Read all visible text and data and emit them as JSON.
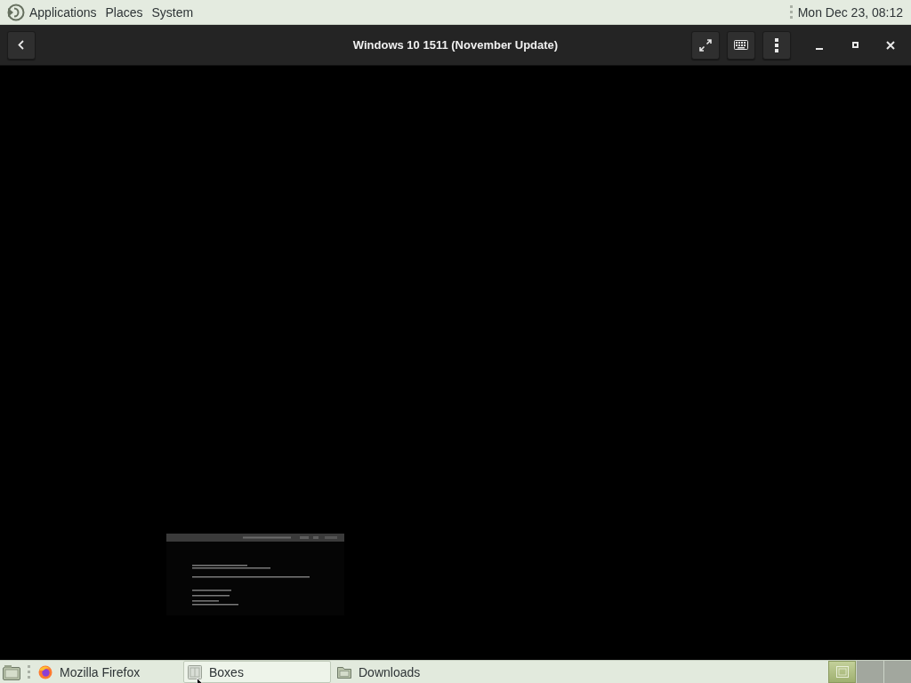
{
  "top_panel": {
    "menus": [
      "Applications",
      "Places",
      "System"
    ],
    "clock": "Mon Dec 23, 08:12"
  },
  "header_bar": {
    "title": "Windows 10 1511 (November Update)"
  },
  "taskbar": {
    "windows": [
      {
        "label": "Mozilla Firefox",
        "kind": "browser",
        "selected": false
      },
      {
        "label": "Boxes",
        "kind": "app",
        "selected": true
      },
      {
        "label": "Downloads",
        "kind": "folder",
        "selected": false
      }
    ],
    "workspaces": [
      {
        "selected": true
      },
      {
        "selected": false
      },
      {
        "selected": false
      }
    ]
  }
}
